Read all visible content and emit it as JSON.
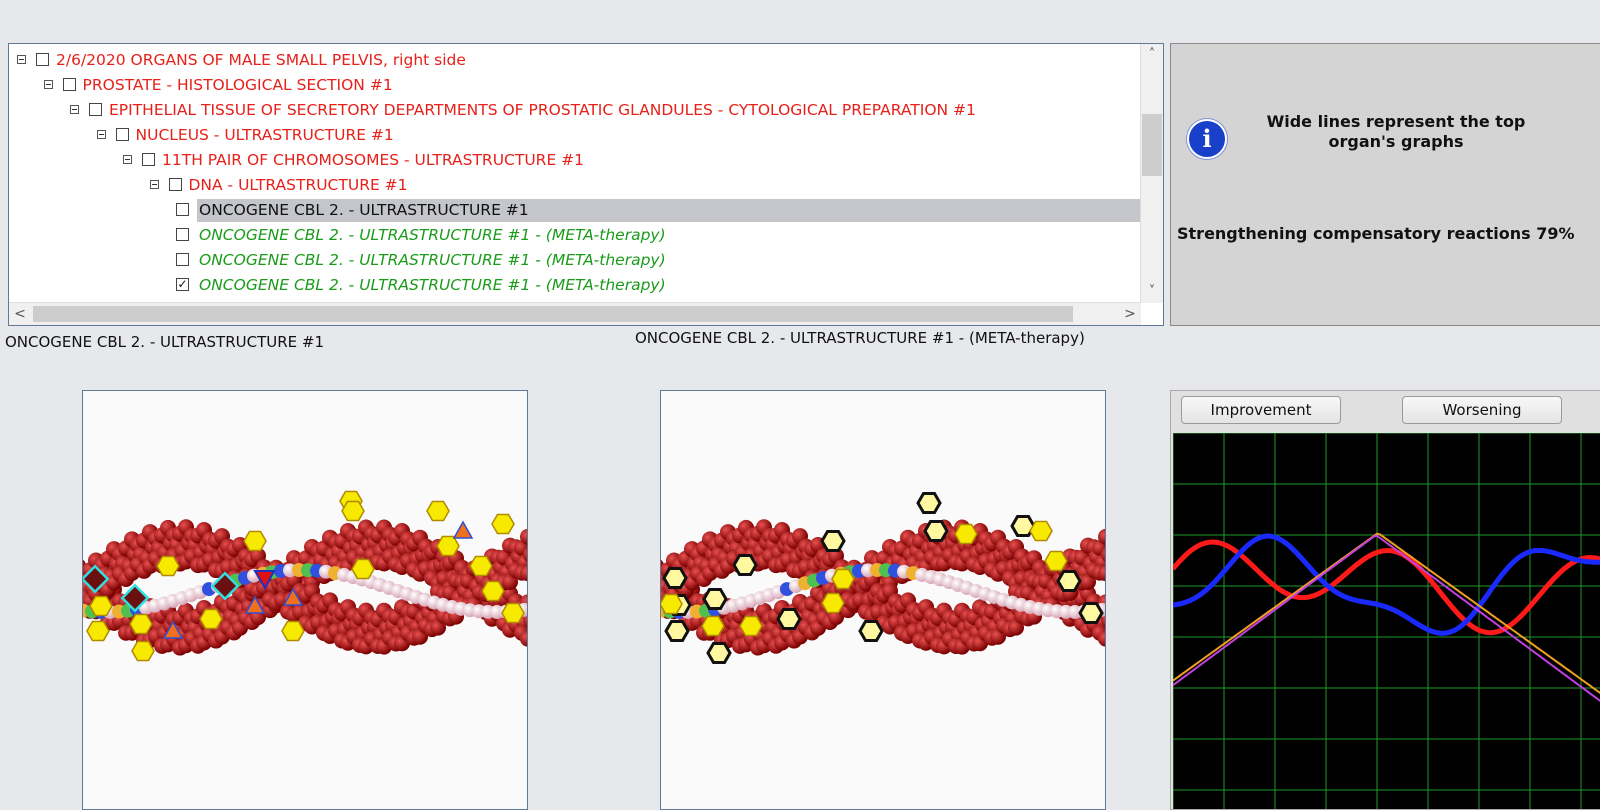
{
  "tree": {
    "rows": [
      {
        "indent": 0,
        "expander": true,
        "checked": false,
        "label": "2/6/2020  ORGANS OF MALE SMALL PELVIS, right side",
        "style": "red"
      },
      {
        "indent": 1,
        "expander": true,
        "checked": false,
        "label": "PROSTATE - HISTOLOGICAL SECTION #1",
        "style": "red"
      },
      {
        "indent": 2,
        "expander": true,
        "checked": false,
        "label": "EPITHELIAL TISSUE OF SECRETORY DEPARTMENTS OF PROSTATIC GLANDULES - CYTOLOGICAL PREPARATION #1",
        "style": "red"
      },
      {
        "indent": 3,
        "expander": true,
        "checked": false,
        "label": "NUCLEUS - ULTRASTRUCTURE #1",
        "style": "red"
      },
      {
        "indent": 4,
        "expander": true,
        "checked": false,
        "label": "11TH PAIR OF CHROMOSOMES - ULTRASTRUCTURE #1",
        "style": "red"
      },
      {
        "indent": 5,
        "expander": true,
        "checked": false,
        "label": "DNA - ULTRASTRUCTURE #1",
        "style": "red"
      },
      {
        "indent": 6,
        "expander": false,
        "checked": false,
        "label": "ONCOGENE CBL 2. - ULTRASTRUCTURE #1",
        "style": "black",
        "selected": true
      },
      {
        "indent": 6,
        "expander": false,
        "checked": false,
        "label": "ONCOGENE CBL 2. - ULTRASTRUCTURE #1 - (META-therapy)",
        "style": "green"
      },
      {
        "indent": 6,
        "expander": false,
        "checked": false,
        "label": "ONCOGENE CBL 2. - ULTRASTRUCTURE #1 - (META-therapy)",
        "style": "green"
      },
      {
        "indent": 6,
        "expander": false,
        "checked": true,
        "label": "ONCOGENE CBL 2. - ULTRASTRUCTURE #1 - (META-therapy)",
        "style": "green"
      }
    ],
    "checkmark": "✓",
    "scroll_up": "˄",
    "scroll_down": "˅",
    "scroll_left": "<",
    "scroll_right": ">"
  },
  "info": {
    "icon": "i",
    "message": "Wide lines represent the top organ's graphs",
    "status": "Strengthening compensatory reactions 79%"
  },
  "captions": {
    "left": "ONCOGENE CBL 2. - ULTRASTRUCTURE #1",
    "right": "ONCOGENE CBL 2. - ULTRASTRUCTURE #1 - (META-therapy)"
  },
  "graph": {
    "improvement_label": "Improvement",
    "worsening_label": "Worsening",
    "colors": {
      "red": "#ff1a1a",
      "blue": "#1a2aff",
      "grid": "#1e9a2a",
      "background": "#000000"
    }
  }
}
